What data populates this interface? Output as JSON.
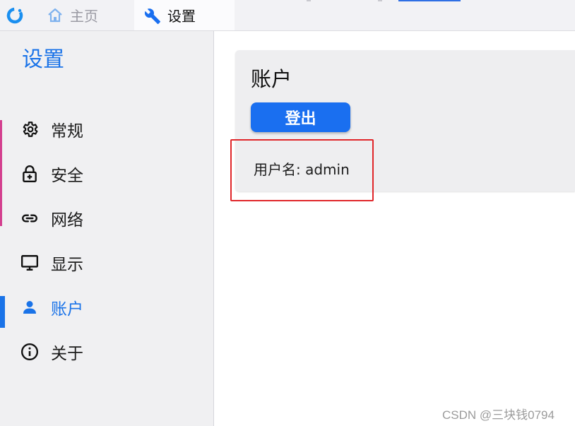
{
  "tabs": [
    {
      "label": "主页",
      "icon": "home-icon"
    },
    {
      "label": "设置",
      "icon": "wrench-icon"
    }
  ],
  "sidebar": {
    "title": "设置",
    "items": [
      {
        "label": "常规",
        "icon": "gear-icon"
      },
      {
        "label": "安全",
        "icon": "lock-icon"
      },
      {
        "label": "网络",
        "icon": "link-icon"
      },
      {
        "label": "显示",
        "icon": "monitor-icon"
      },
      {
        "label": "账户",
        "icon": "person-icon",
        "active": true
      },
      {
        "label": "关于",
        "icon": "info-icon"
      }
    ]
  },
  "account": {
    "title": "账户",
    "logout_label": "登出",
    "username_text": "用户名: admin"
  },
  "watermark": "CSDN @三块钱0794",
  "colors": {
    "accent": "#1a73e8",
    "button": "#1a6ff0",
    "highlight": "#e0262a",
    "sidebar_bg": "#f0f0f2"
  }
}
